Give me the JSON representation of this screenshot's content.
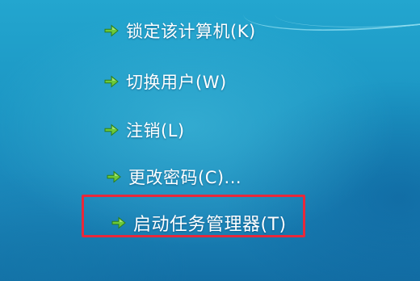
{
  "menu": {
    "items": [
      {
        "label": "锁定该计算机(K)",
        "icon": "green-arrow-icon"
      },
      {
        "label": "切换用户(W)",
        "icon": "green-arrow-icon"
      },
      {
        "label": "注销(L)",
        "icon": "green-arrow-icon"
      },
      {
        "label": "更改密码(C)...",
        "icon": "green-arrow-icon"
      },
      {
        "label": "启动任务管理器(T)",
        "icon": "green-arrow-icon"
      }
    ]
  },
  "colors": {
    "background": "#1b95c3",
    "text": "#ffffff",
    "arrow": "#6cc93a",
    "highlight": "#e8283a"
  }
}
